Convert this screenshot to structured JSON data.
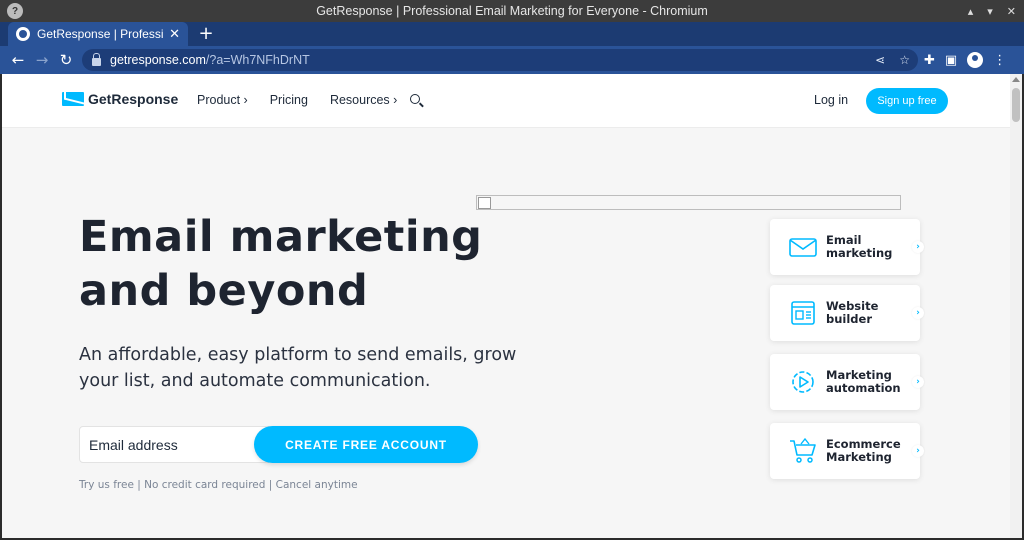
{
  "window": {
    "title": "GetResponse | Professional Email Marketing for Everyone - Chromium",
    "controls": [
      "▴",
      "▾",
      "✕"
    ]
  },
  "browser": {
    "tab_title": "GetResponse | Professional",
    "url_host": "getresponse.com",
    "url_path": "/?a=Wh7NFhDrNT"
  },
  "header": {
    "logo_text": "GetResponse",
    "nav": [
      {
        "label": "Product ›"
      },
      {
        "label": "Pricing"
      },
      {
        "label": "Resources ›"
      }
    ],
    "login": "Log in",
    "signup": "Sign up free"
  },
  "hero": {
    "title": "Email marketing and beyond",
    "subtitle": "An affordable, easy platform to send emails, grow your list, and automate communication.",
    "email_placeholder": "Email address",
    "cta": "CREATE FREE ACCOUNT",
    "fine_print": "Try us free | No credit card required | Cancel anytime"
  },
  "features": [
    {
      "label": "Email marketing",
      "icon": "envelope-icon"
    },
    {
      "label": "Website builder",
      "icon": "website-icon"
    },
    {
      "label": "Marketing automation",
      "icon": "automation-gear-icon"
    },
    {
      "label": "Ecommerce Marketing",
      "icon": "shopping-cart-icon"
    }
  ],
  "colors": {
    "accent": "#00baff",
    "browser_chrome": "#2a5398",
    "text_dark": "#1e2430"
  }
}
